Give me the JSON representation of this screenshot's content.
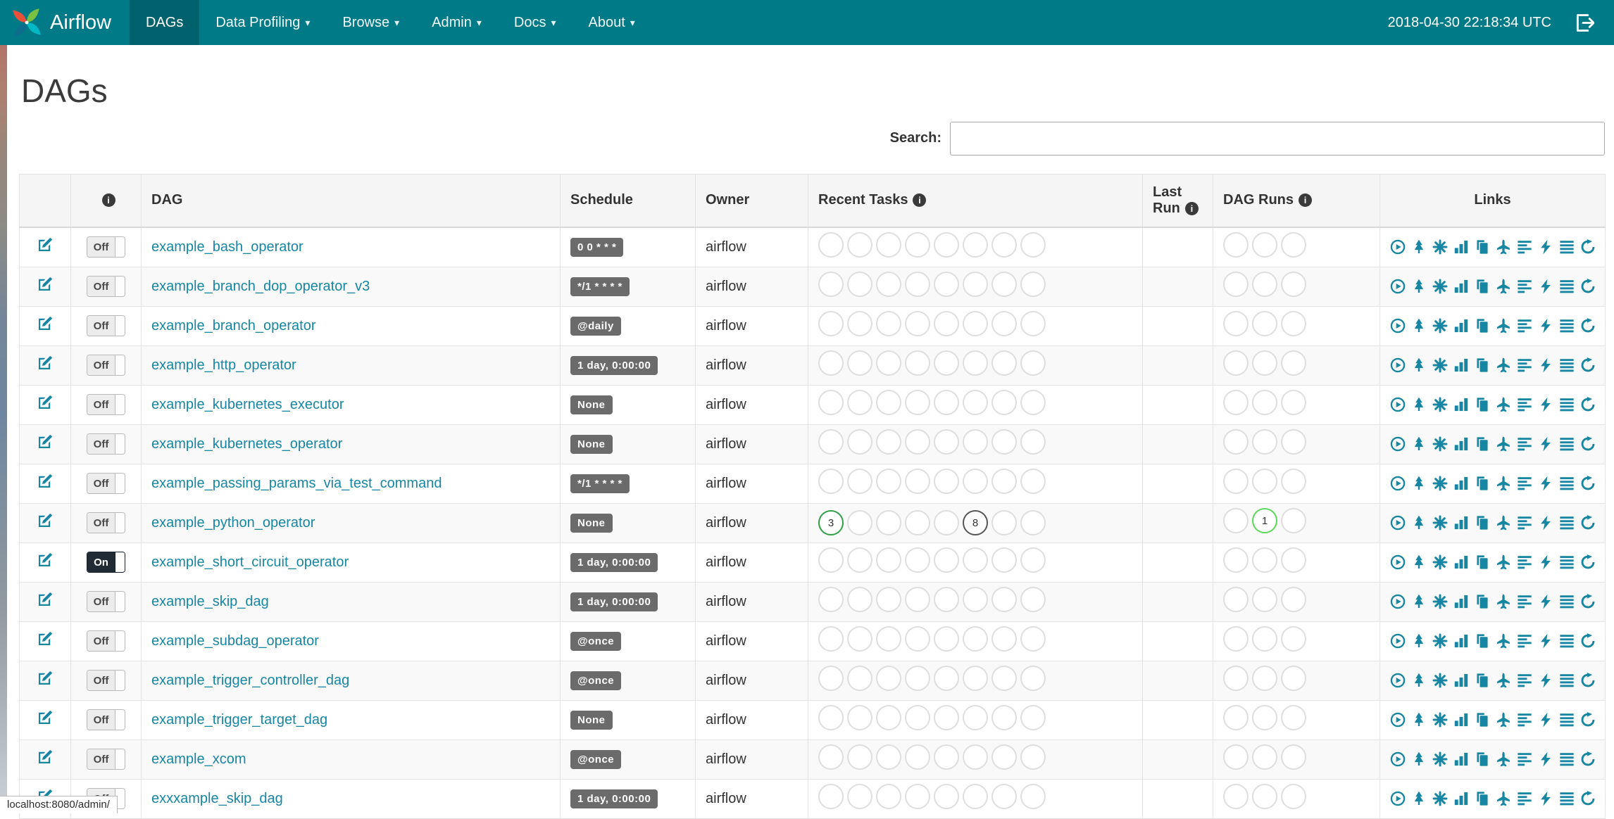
{
  "navbar": {
    "brand": "Airflow",
    "caret_glyph": "▾",
    "items": [
      {
        "label": "DAGs",
        "active": true,
        "dropdown": false
      },
      {
        "label": "Data Profiling",
        "active": false,
        "dropdown": true
      },
      {
        "label": "Browse",
        "active": false,
        "dropdown": true
      },
      {
        "label": "Admin",
        "active": false,
        "dropdown": true
      },
      {
        "label": "Docs",
        "active": false,
        "dropdown": true
      },
      {
        "label": "About",
        "active": false,
        "dropdown": true
      }
    ],
    "clock": "2018-04-30 22:18:34 UTC"
  },
  "page": {
    "title": "DAGs"
  },
  "search": {
    "label": "Search:",
    "value": ""
  },
  "colors": {
    "navbar": "#007a87",
    "nav_active": "#00626d",
    "accent_link": "#1786a3",
    "badge": "#6b6b6b"
  },
  "table": {
    "info_glyph": "i",
    "headers": {
      "edit": "",
      "dag": "DAG",
      "schedule": "Schedule",
      "owner": "Owner",
      "recent_tasks": "Recent Tasks",
      "last_run": "Last Run",
      "dag_runs": "DAG Runs",
      "links": "Links"
    },
    "recent_task_slots": 8,
    "dag_run_slots": 3,
    "state_colors": {
      "success": "#2f9e44",
      "running": "#5bd75b",
      "none": "#555555"
    },
    "links": [
      "trigger-dag",
      "tree-view",
      "graph-view",
      "task-duration",
      "task-tries",
      "landing-times",
      "gantt",
      "code-view",
      "logs",
      "refresh"
    ],
    "rows": [
      {
        "dag": "example_bash_operator",
        "toggle": "Off",
        "schedule": "0 0 * * *",
        "owner": "airflow",
        "last_run": ""
      },
      {
        "dag": "example_branch_dop_operator_v3",
        "toggle": "Off",
        "schedule": "*/1 * * * *",
        "owner": "airflow",
        "last_run": ""
      },
      {
        "dag": "example_branch_operator",
        "toggle": "Off",
        "schedule": "@daily",
        "owner": "airflow",
        "last_run": ""
      },
      {
        "dag": "example_http_operator",
        "toggle": "Off",
        "schedule": "1 day, 0:00:00",
        "owner": "airflow",
        "last_run": ""
      },
      {
        "dag": "example_kubernetes_executor",
        "toggle": "Off",
        "schedule": "None",
        "owner": "airflow",
        "last_run": ""
      },
      {
        "dag": "example_kubernetes_operator",
        "toggle": "Off",
        "schedule": "None",
        "owner": "airflow",
        "last_run": ""
      },
      {
        "dag": "example_passing_params_via_test_command",
        "toggle": "Off",
        "schedule": "*/1 * * * *",
        "owner": "airflow",
        "last_run": ""
      },
      {
        "dag": "example_python_operator",
        "toggle": "Off",
        "schedule": "None",
        "owner": "airflow",
        "last_run": "",
        "recent_tasks": [
          {
            "count": 3,
            "state": "success"
          },
          null,
          null,
          null,
          null,
          {
            "count": 8,
            "state": "none"
          },
          null,
          null
        ],
        "dag_runs": [
          null,
          {
            "count": 1,
            "state": "running"
          },
          null
        ]
      },
      {
        "dag": "example_short_circuit_operator",
        "toggle": "On",
        "schedule": "1 day, 0:00:00",
        "owner": "airflow",
        "last_run": ""
      },
      {
        "dag": "example_skip_dag",
        "toggle": "Off",
        "schedule": "1 day, 0:00:00",
        "owner": "airflow",
        "last_run": ""
      },
      {
        "dag": "example_subdag_operator",
        "toggle": "Off",
        "schedule": "@once",
        "owner": "airflow",
        "last_run": ""
      },
      {
        "dag": "example_trigger_controller_dag",
        "toggle": "Off",
        "schedule": "@once",
        "owner": "airflow",
        "last_run": ""
      },
      {
        "dag": "example_trigger_target_dag",
        "toggle": "Off",
        "schedule": "None",
        "owner": "airflow",
        "last_run": ""
      },
      {
        "dag": "example_xcom",
        "toggle": "Off",
        "schedule": "@once",
        "owner": "airflow",
        "last_run": ""
      },
      {
        "dag": "exxxample_skip_dag",
        "toggle": "Off",
        "schedule": "1 day, 0:00:00",
        "owner": "airflow",
        "last_run": ""
      }
    ]
  },
  "statusbar": {
    "url": "localhost:8080/admin/"
  }
}
